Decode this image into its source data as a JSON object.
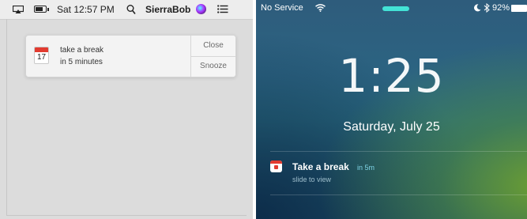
{
  "mac": {
    "menubar": {
      "clock": "Sat 12:57 PM",
      "user": "SierraBob",
      "icons": [
        "airplay-icon",
        "battery-icon",
        "search-icon",
        "siri-icon",
        "notification-center-icon"
      ]
    },
    "notification": {
      "icon": "calendar-icon",
      "calendar_day": "17",
      "title": "take a break",
      "subtitle": "in 5 minutes",
      "close_label": "Close",
      "snooze_label": "Snooze"
    }
  },
  "ios": {
    "status": {
      "carrier": "No Service",
      "battery_percent": "92%",
      "accent_pill_color": "#43e3d6"
    },
    "time": "1:25",
    "date": "Saturday, July 25",
    "notification": {
      "icon": "calendar-icon",
      "title": "Take a break",
      "when": "in 5m",
      "action_hint": "slide to view"
    }
  },
  "colors": {
    "calendar_red": "#e23b30",
    "ios_link": "#7fd4e6"
  }
}
